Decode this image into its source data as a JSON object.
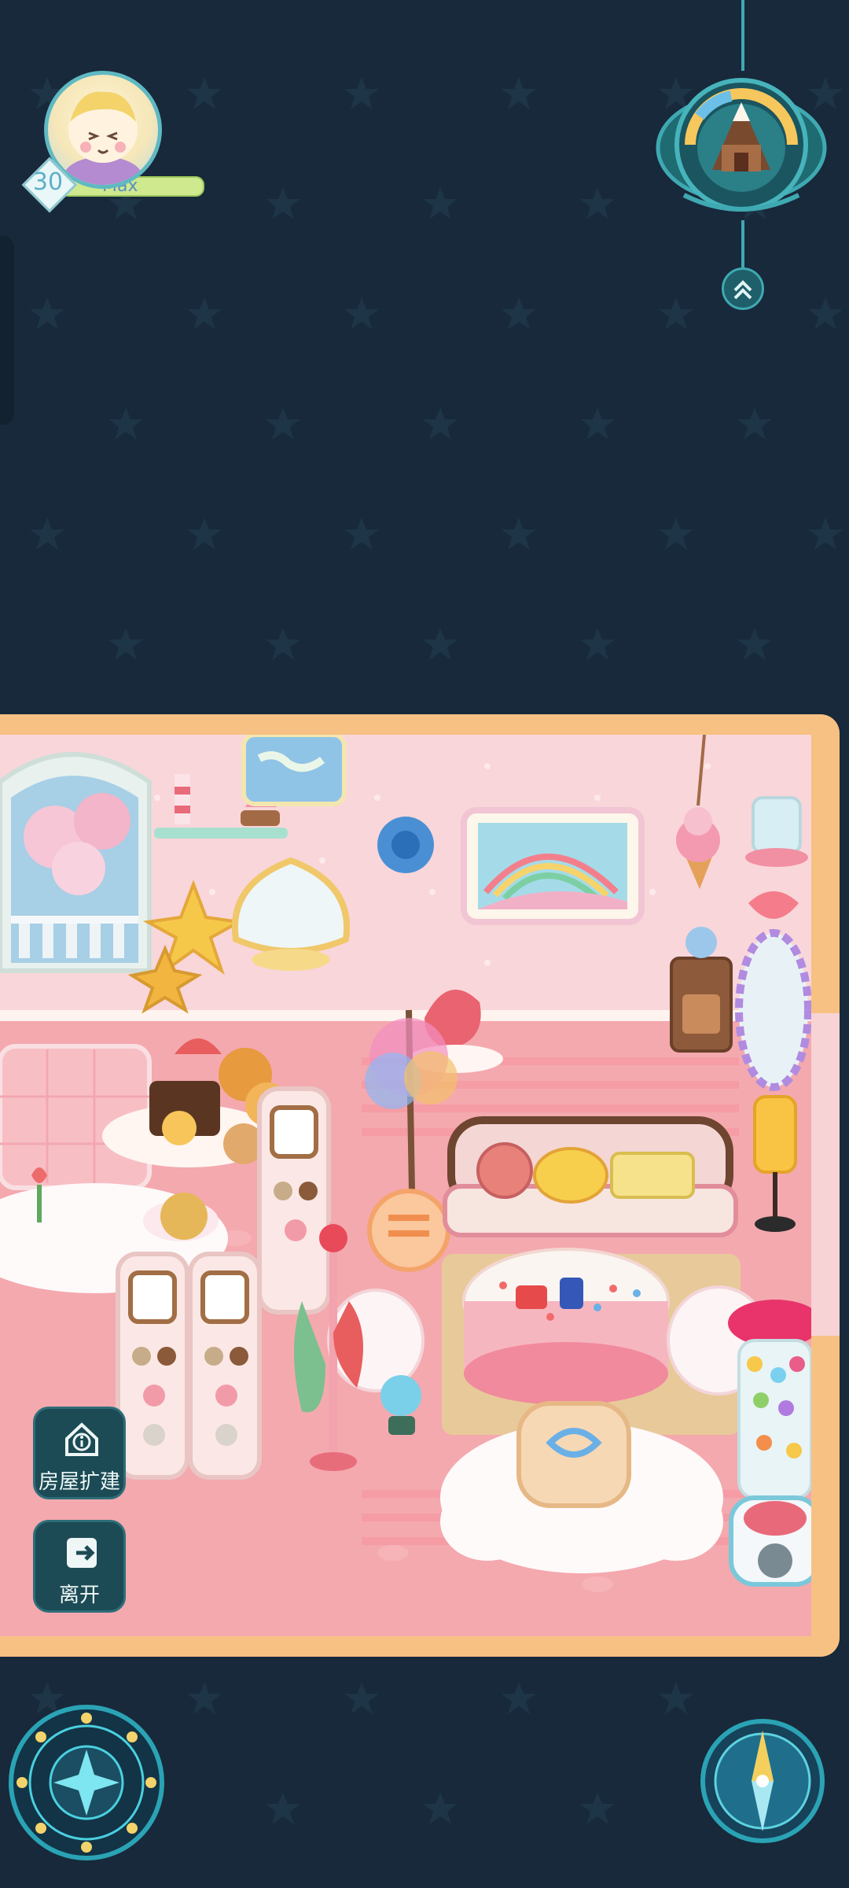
{
  "player": {
    "level": "30",
    "name": "Max"
  },
  "buttons": {
    "house_expand": "房屋扩建",
    "leave": "离开"
  },
  "icons": {
    "avatar": "avatar-portrait",
    "top_right": "gingerbread-house-badge",
    "collapse": "chevron-double-up-icon",
    "house_info": "house-info-icon",
    "leave": "exit-door-icon",
    "magic_circle": "magic-circle-icon",
    "compass": "compass-icon"
  },
  "colors": {
    "background": "#17293a",
    "room_frame": "#f7c183",
    "room_wall": "#f8c6c9",
    "accent": "#3fa9b2"
  }
}
